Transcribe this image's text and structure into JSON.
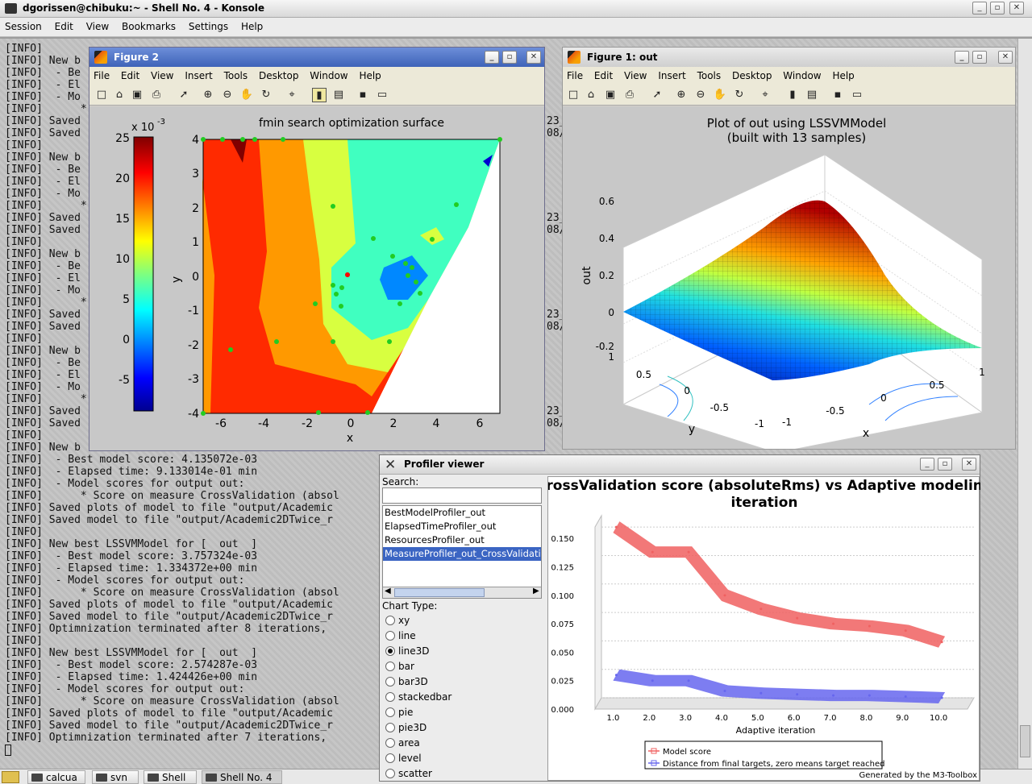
{
  "konsole": {
    "title": "dgorissen@chibuku:~ - Shell No. 4 - Konsole",
    "menu": [
      "Session",
      "Edit",
      "View",
      "Bookmarks",
      "Settings",
      "Help"
    ],
    "terminal_lines": [
      "[INFO]",
      "[INFO] New b",
      "[INFO]  - Be",
      "[INFO]  - El",
      "[INFO]  - Mo",
      "[INFO]      *",
      "[INFO] Saved",
      "[INFO] Saved",
      "[INFO]",
      "[INFO] New b",
      "[INFO]  - Be",
      "[INFO]  - El",
      "[INFO]  - Mo",
      "[INFO]      *",
      "[INFO] Saved",
      "[INFO] Saved",
      "[INFO]",
      "[INFO] New b",
      "[INFO]  - Be",
      "[INFO]  - El",
      "[INFO]  - Mo",
      "[INFO]      *",
      "[INFO] Saved",
      "[INFO] Saved",
      "[INFO]",
      "[INFO] New b",
      "[INFO]  - Be",
      "[INFO]  - El",
      "[INFO]  - Mo",
      "[INFO]      *",
      "[INFO] Saved",
      "[INFO] Saved",
      "[INFO]",
      "[INFO] New b",
      "[INFO]  - Best model score: 4.135072e-03",
      "[INFO]  - Elapsed time: 9.133014e-01 min",
      "[INFO]  - Model scores for output out:",
      "[INFO]      * Score on measure CrossValidation (absol",
      "[INFO] Saved plots of model to file \"output/Academic",
      "[INFO] Saved model to file \"output/Academic2DTwice_r",
      "[INFO]",
      "[INFO] New best LSSVMModel for [  out  ]",
      "[INFO]  - Best model score: 3.757324e-03",
      "[INFO]  - Elapsed time: 1.334372e+00 min",
      "[INFO]  - Model scores for output out:",
      "[INFO]      * Score on measure CrossValidation (absol",
      "[INFO] Saved plots of model to file \"output/Academic",
      "[INFO] Saved model to file \"output/Academic2DTwice_r",
      "[INFO] Optimnization terminated after 8 iterations,",
      "[INFO]",
      "[INFO] New best LSSVMModel for [  out  ]",
      "[INFO]  - Best model score: 2.574287e-03",
      "[INFO]  - Elapsed time: 1.424426e+00 min",
      "[INFO]  - Model scores for output out:",
      "[INFO]      * Score on measure CrossValidation (absol",
      "[INFO] Saved plots of model to file \"output/Academic",
      "[INFO] Saved model to file \"output/Academic2DTwice_r",
      "[INFO] Optimnization terminated after 7 iterations,"
    ],
    "right_fragments": [
      "23_",
      "08/",
      "23_",
      "08/",
      "23_",
      "08/",
      "23_",
      "08/"
    ]
  },
  "taskbar": {
    "tasks": [
      "calcua",
      "svn",
      "Shell",
      "Shell No. 4"
    ]
  },
  "figure2": {
    "title": "Figure 2",
    "menu": [
      "File",
      "Edit",
      "View",
      "Insert",
      "Tools",
      "Desktop",
      "Window",
      "Help"
    ],
    "plot_title": "fmin search optimization surface",
    "xlabel": "x",
    "ylabel": "y",
    "xticks": [
      "-6",
      "-4",
      "-2",
      "0",
      "2",
      "4",
      "6"
    ],
    "yticks": [
      "4",
      "3",
      "2",
      "1",
      "0",
      "-1",
      "-2",
      "-3",
      "-4"
    ],
    "colorbar_exp": "x 10",
    "colorbar_exp_power": "-3",
    "colorbar_ticks": [
      "25",
      "20",
      "15",
      "10",
      "5",
      "0",
      "-5"
    ]
  },
  "figure1": {
    "title": "Figure 1: out",
    "menu": [
      "File",
      "Edit",
      "View",
      "Insert",
      "Tools",
      "Desktop",
      "Window",
      "Help"
    ],
    "plot_title_1": "Plot of out using LSSVMModel",
    "plot_title_2": "(built with 13 samples)",
    "zlabel": "out",
    "xlabel": "x",
    "ylabel": "y",
    "zticks": [
      "0.6",
      "0.4",
      "0.2",
      "0",
      "-0.2"
    ],
    "yticks": [
      "1",
      "0.5",
      "0",
      "-0.5",
      "-1"
    ],
    "xticks": [
      "-1",
      "-0.5",
      "0",
      "0.5",
      "1"
    ]
  },
  "profiler": {
    "title": "Profiler viewer",
    "search_label": "Search:",
    "search_value": "",
    "profilers": [
      "BestModelProfiler_out",
      "ElapsedTimeProfiler_out",
      "ResourcesProfiler_out",
      "MeasureProfiler_out_CrossValidati"
    ],
    "selected_profiler": 3,
    "chart_type_label": "Chart Type:",
    "chart_types": [
      "xy",
      "line",
      "line3D",
      "bar",
      "bar3D",
      "stackedbar",
      "pie",
      "pie3D",
      "area",
      "level",
      "scatter"
    ],
    "selected_chart_type": 2,
    "footer": "Generated by the M3-Toolbox"
  },
  "chart_data": {
    "type": "line",
    "title": "CrossValidation score (absoluteRms) vs Adaptive modeling iteration",
    "xlabel": "Adaptive iteration",
    "ylabel": "",
    "x": [
      1.0,
      2.0,
      3.0,
      4.0,
      5.0,
      6.0,
      7.0,
      8.0,
      9.0,
      10.0
    ],
    "x_tick_labels": [
      "1.0",
      "2.0",
      "3.0",
      "4.0",
      "5.0",
      "6.0",
      "7.0",
      "8.0",
      "9.0",
      "10.0"
    ],
    "y_tick_labels": [
      "0.000",
      "0.025",
      "0.050",
      "0.075",
      "0.100",
      "0.125",
      "0.150"
    ],
    "ylim": [
      0,
      0.16
    ],
    "legend_position": "bottom",
    "series": [
      {
        "name": "Model score",
        "color": "#f06060",
        "values": [
          0.155,
          0.133,
          0.133,
          0.095,
          0.083,
          0.075,
          0.07,
          0.068,
          0.064,
          0.054
        ]
      },
      {
        "name": "Distance from final targets, zero means target reached",
        "color": "#6666ee",
        "values": [
          0.025,
          0.02,
          0.02,
          0.011,
          0.009,
          0.008,
          0.007,
          0.007,
          0.006,
          0.005
        ]
      }
    ]
  }
}
